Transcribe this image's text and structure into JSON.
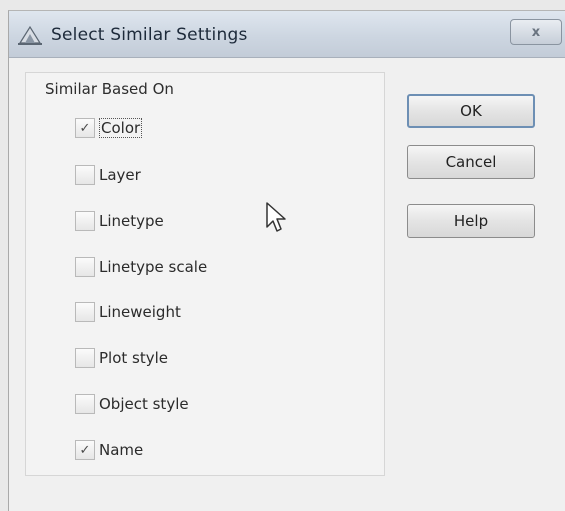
{
  "window": {
    "title": "Select Similar Settings",
    "close_label": "x",
    "icon": "autocad-app-icon"
  },
  "group": {
    "label": "Similar Based On",
    "options": [
      {
        "label": "Color",
        "checked": true
      },
      {
        "label": "Layer",
        "checked": false
      },
      {
        "label": "Linetype",
        "checked": false
      },
      {
        "label": "Linetype scale",
        "checked": false
      },
      {
        "label": "Lineweight",
        "checked": false
      },
      {
        "label": "Plot style",
        "checked": false
      },
      {
        "label": "Object style",
        "checked": false
      },
      {
        "label": "Name",
        "checked": true
      }
    ]
  },
  "buttons": {
    "ok": "OK",
    "cancel": "Cancel",
    "help": "Help"
  },
  "colors": {
    "titlebar": "#cdd6e1",
    "background": "#f0f0f0",
    "default_button_border": "#6d8fb4"
  }
}
